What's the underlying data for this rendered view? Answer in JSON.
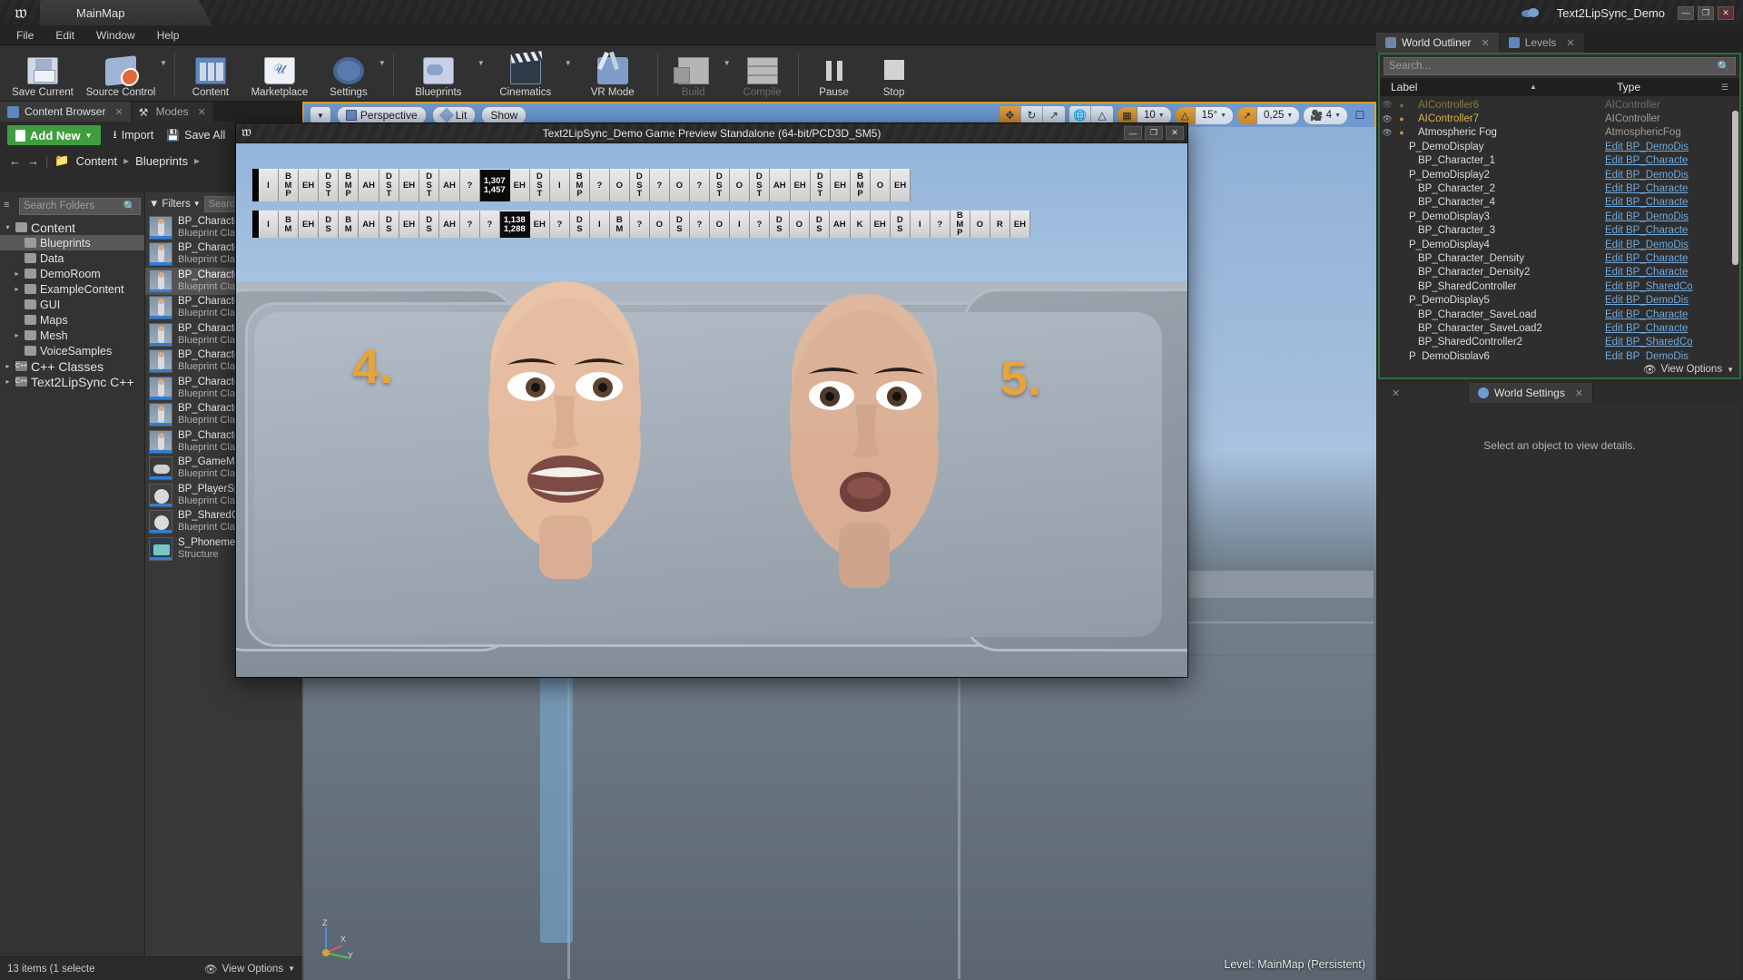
{
  "titlebar": {
    "map_tab": "MainMap",
    "project_name": "Text2LipSync_Demo",
    "minimize": "—",
    "maximize": "❐",
    "close": "✕",
    "cloud_icon": "cloud-icon",
    "logo_icon": "unreal-logo-icon"
  },
  "menubar": {
    "items": [
      "File",
      "Edit",
      "Window",
      "Help"
    ]
  },
  "toolbar": {
    "groups": [
      {
        "buttons": [
          {
            "label": "Save Current",
            "icon": "save-icon",
            "caret": false,
            "disabled": false
          },
          {
            "label": "Source Control",
            "icon": "source-control-icon",
            "caret": true,
            "disabled": false
          }
        ]
      },
      {
        "buttons": [
          {
            "label": "Content",
            "icon": "content-icon",
            "caret": false,
            "disabled": false
          },
          {
            "label": "Marketplace",
            "icon": "marketplace-icon",
            "caret": false,
            "disabled": false
          },
          {
            "label": "Settings",
            "icon": "settings-gear-icon",
            "caret": true,
            "disabled": false
          }
        ]
      },
      {
        "buttons": [
          {
            "label": "Blueprints",
            "icon": "blueprints-icon",
            "caret": true,
            "disabled": false
          },
          {
            "label": "Cinematics",
            "icon": "cinematics-icon",
            "caret": true,
            "disabled": false
          },
          {
            "label": "VR Mode",
            "icon": "vr-mode-icon",
            "caret": false,
            "disabled": false
          }
        ]
      },
      {
        "buttons": [
          {
            "label": "Build",
            "icon": "build-icon",
            "caret": true,
            "disabled": true
          },
          {
            "label": "Compile",
            "icon": "compile-icon",
            "caret": false,
            "disabled": true
          }
        ]
      },
      {
        "buttons": [
          {
            "label": "Pause",
            "icon": "pause-icon",
            "caret": false,
            "disabled": false
          },
          {
            "label": "Stop",
            "icon": "stop-icon",
            "caret": false,
            "disabled": false
          }
        ]
      }
    ]
  },
  "content_browser": {
    "tabs": [
      {
        "label": "Content Browser",
        "icon": "content-browser-icon",
        "active": true
      },
      {
        "label": "Modes",
        "icon": "modes-icon",
        "active": false
      }
    ],
    "add_new": "Add New",
    "import": "Import",
    "save_all": "Save All",
    "breadcrumb": [
      "Content",
      "Blueprints"
    ],
    "folder_search_placeholder": "Search Folders",
    "asset_search_placeholder": "Search Blueprints",
    "filters_label": "Filters",
    "tree": [
      {
        "label": "Content",
        "depth": 0,
        "twisty": "▾",
        "selected": false,
        "root": true
      },
      {
        "label": "Blueprints",
        "depth": 1,
        "twisty": "",
        "selected": true
      },
      {
        "label": "Data",
        "depth": 1,
        "twisty": "",
        "selected": false
      },
      {
        "label": "DemoRoom",
        "depth": 1,
        "twisty": "▸",
        "selected": false
      },
      {
        "label": "ExampleContent",
        "depth": 1,
        "twisty": "▸",
        "selected": false
      },
      {
        "label": "GUI",
        "depth": 1,
        "twisty": "",
        "selected": false
      },
      {
        "label": "Maps",
        "depth": 1,
        "twisty": "",
        "selected": false
      },
      {
        "label": "Mesh",
        "depth": 1,
        "twisty": "▸",
        "selected": false
      },
      {
        "label": "VoiceSamples",
        "depth": 1,
        "twisty": "",
        "selected": false
      },
      {
        "label": "C++ Classes",
        "depth": 0,
        "twisty": "▸",
        "selected": false,
        "cpp": true,
        "root": true
      },
      {
        "label": "Text2LipSync C++",
        "depth": 0,
        "twisty": "▸",
        "selected": false,
        "cpp": true,
        "root": true
      }
    ],
    "assets": [
      {
        "name": "BP_Character_Bas",
        "type": "Blueprint Class",
        "thumb": "character",
        "selected": false
      },
      {
        "name": "BP_Character_Bas",
        "type": "Blueprint Class",
        "thumb": "character",
        "selected": false
      },
      {
        "name": "BP_Character_Data",
        "type": "Blueprint Class",
        "thumb": "character",
        "selected": true
      },
      {
        "name": "BP_Character_Data",
        "type": "Blueprint Class",
        "thumb": "character",
        "selected": false
      },
      {
        "name": "BP_Character_Data",
        "type": "Blueprint Class",
        "thumb": "character",
        "selected": false
      },
      {
        "name": "BP_Character_Den",
        "type": "Blueprint Class",
        "thumb": "character",
        "selected": false
      },
      {
        "name": "BP_Character_Noti",
        "type": "Blueprint Class",
        "thumb": "character",
        "selected": false
      },
      {
        "name": "BP_Character_Play",
        "type": "Blueprint Class",
        "thumb": "character",
        "selected": false
      },
      {
        "name": "BP_Character_Sav",
        "type": "Blueprint Class",
        "thumb": "character",
        "selected": false
      },
      {
        "name": "BP_GameMode",
        "type": "Blueprint Class",
        "thumb": "gamemode",
        "selected": false
      },
      {
        "name": "BP_PlayerSpectato",
        "type": "Blueprint Class",
        "thumb": "sphere",
        "selected": false
      },
      {
        "name": "BP_SharedControl",
        "type": "Blueprint Class",
        "thumb": "sphere",
        "selected": false
      },
      {
        "name": "S_PhonemeVisuali",
        "type": "Structure",
        "thumb": "struct",
        "selected": false
      }
    ],
    "footer_status": "13 items (1 selecte",
    "view_options": "View Options"
  },
  "viewport": {
    "perspective": "Perspective",
    "lit": "Lit",
    "show": "Show",
    "grid_snap": "10",
    "angle_snap": "15°",
    "scale_snap": "0,25",
    "camera_speed": "4",
    "level_info": "Level:  MainMap (Persistent)",
    "icons": {
      "dropdown": "chevron-down-icon",
      "move": "move-gizmo-icon",
      "rotate": "rotate-gizmo-icon",
      "scale": "scale-gizmo-icon",
      "world": "world-coords-icon",
      "surface": "surface-snap-icon",
      "grid": "grid-snap-icon",
      "angle": "angle-snap-icon",
      "scale_snap": "scale-snap-icon",
      "camera": "camera-speed-icon",
      "maximize": "maximize-viewport-icon"
    },
    "axis": {
      "x": "X",
      "y": "Y",
      "z": "Z"
    }
  },
  "right_panels": {
    "tabs": [
      {
        "label": "World Outliner",
        "icon": "outliner-icon",
        "active": true
      },
      {
        "label": "Levels",
        "icon": "levels-icon",
        "active": false
      }
    ],
    "outliner": {
      "search_placeholder": "Search...",
      "col_label": "Label",
      "col_type": "Type",
      "view_options": "View Options",
      "rows": [
        {
          "label": "AIController6",
          "type": "AIController",
          "indent": 1,
          "link": false,
          "highlight": true,
          "eye": true,
          "clipped": true
        },
        {
          "label": "AIController7",
          "type": "AIController",
          "indent": 1,
          "link": false,
          "highlight": true,
          "eye": true
        },
        {
          "label": "Atmospheric Fog",
          "type": "AtmosphericFog",
          "indent": 1,
          "link": false,
          "highlight": false,
          "eye": true
        },
        {
          "label": "P_DemoDisplay",
          "type": "Edit BP_DemoDis",
          "indent": 0,
          "link": true,
          "highlight": false
        },
        {
          "label": "BP_Character_1",
          "type": "Edit BP_Characte",
          "indent": 1,
          "link": true,
          "highlight": false
        },
        {
          "label": "P_DemoDisplay2",
          "type": "Edit BP_DemoDis",
          "indent": 0,
          "link": true,
          "highlight": false
        },
        {
          "label": "BP_Character_2",
          "type": "Edit BP_Characte",
          "indent": 1,
          "link": true,
          "highlight": false
        },
        {
          "label": "BP_Character_4",
          "type": "Edit BP_Characte",
          "indent": 1,
          "link": true,
          "highlight": false
        },
        {
          "label": "P_DemoDisplay3",
          "type": "Edit BP_DemoDis",
          "indent": 0,
          "link": true,
          "highlight": false
        },
        {
          "label": "BP_Character_3",
          "type": "Edit BP_Characte",
          "indent": 1,
          "link": true,
          "highlight": false
        },
        {
          "label": "P_DemoDisplay4",
          "type": "Edit BP_DemoDis",
          "indent": 0,
          "link": true,
          "highlight": false
        },
        {
          "label": "BP_Character_Density",
          "type": "Edit BP_Characte",
          "indent": 1,
          "link": true,
          "highlight": false
        },
        {
          "label": "BP_Character_Density2",
          "type": "Edit BP_Characte",
          "indent": 1,
          "link": true,
          "highlight": false
        },
        {
          "label": "BP_SharedController",
          "type": "Edit BP_SharedCo",
          "indent": 1,
          "link": true,
          "highlight": false
        },
        {
          "label": "P_DemoDisplay5",
          "type": "Edit BP_DemoDis",
          "indent": 0,
          "link": true,
          "highlight": false
        },
        {
          "label": "BP_Character_SaveLoad",
          "type": "Edit BP_Characte",
          "indent": 1,
          "link": true,
          "highlight": false
        },
        {
          "label": "BP_Character_SaveLoad2",
          "type": "Edit BP_Characte",
          "indent": 1,
          "link": true,
          "highlight": false
        },
        {
          "label": "BP_SharedController2",
          "type": "Edit BP_SharedCo",
          "indent": 1,
          "link": true,
          "highlight": false
        },
        {
          "label": "P_DemoDisplay6",
          "type": "Edit BP_DemoDis",
          "indent": 0,
          "link": true,
          "highlight": false
        }
      ]
    },
    "world_settings": {
      "tab_label": "World Settings",
      "message": "Select an object to view details."
    }
  },
  "game_window": {
    "title": "Text2LipSync_Demo Game Preview Standalone (64-bit/PCD3D_SM5)",
    "minimize": "—",
    "maximize": "❐",
    "close": "✕",
    "digit_left": "4.",
    "digit_right": "5.",
    "phoneme_rows": [
      {
        "row_id": "phoneme-row-top",
        "cells": [
          {
            "text": "I",
            "dark": false
          },
          {
            "text": "B\nM\nP",
            "dark": false
          },
          {
            "text": "EH",
            "dark": false
          },
          {
            "text": "D\nS\nT",
            "dark": false
          },
          {
            "text": "B\nM\nP",
            "dark": false
          },
          {
            "text": "AH",
            "dark": false
          },
          {
            "text": "D\nS\nT",
            "dark": false
          },
          {
            "text": "EH",
            "dark": false
          },
          {
            "text": "D\nS\nT",
            "dark": false
          },
          {
            "text": "AH",
            "dark": false
          },
          {
            "text": "?",
            "dark": false
          },
          {
            "text": "1,307\n1,457",
            "dark": true
          },
          {
            "text": "EH",
            "dark": false
          },
          {
            "text": "D\nS\nT",
            "dark": false
          },
          {
            "text": "I",
            "dark": false
          },
          {
            "text": "B\nM\nP",
            "dark": false
          },
          {
            "text": "?",
            "dark": false
          },
          {
            "text": "O",
            "dark": false
          },
          {
            "text": "D\nS\nT",
            "dark": false
          },
          {
            "text": "?",
            "dark": false
          },
          {
            "text": "O",
            "dark": false
          },
          {
            "text": "?",
            "dark": false
          },
          {
            "text": "D\nS\nT",
            "dark": false
          },
          {
            "text": "O",
            "dark": false
          },
          {
            "text": "D\nS\nT",
            "dark": false
          },
          {
            "text": "AH",
            "dark": false
          },
          {
            "text": "EH",
            "dark": false
          },
          {
            "text": "D\nS\nT",
            "dark": false
          },
          {
            "text": "EH",
            "dark": false
          },
          {
            "text": "B\nM\nP",
            "dark": false
          },
          {
            "text": "O",
            "dark": false
          },
          {
            "text": "EH",
            "dark": false
          }
        ]
      },
      {
        "row_id": "phoneme-row-bottom",
        "cells": [
          {
            "text": "I",
            "dark": false
          },
          {
            "text": "B\nM",
            "dark": false
          },
          {
            "text": "EH",
            "dark": false
          },
          {
            "text": "D\nS",
            "dark": false
          },
          {
            "text": "B\nM",
            "dark": false
          },
          {
            "text": "AH",
            "dark": false
          },
          {
            "text": "D\nS",
            "dark": false
          },
          {
            "text": "EH",
            "dark": false
          },
          {
            "text": "D\nS",
            "dark": false
          },
          {
            "text": "AH",
            "dark": false
          },
          {
            "text": "?",
            "dark": false
          },
          {
            "text": "?",
            "dark": false
          },
          {
            "text": "1,138\n1,288",
            "dark": true
          },
          {
            "text": "EH",
            "dark": false
          },
          {
            "text": "?",
            "dark": false
          },
          {
            "text": "D\nS",
            "dark": false
          },
          {
            "text": "I",
            "dark": false
          },
          {
            "text": "B\nM",
            "dark": false
          },
          {
            "text": "?",
            "dark": false
          },
          {
            "text": "O",
            "dark": false
          },
          {
            "text": "D\nS",
            "dark": false
          },
          {
            "text": "?",
            "dark": false
          },
          {
            "text": "O",
            "dark": false
          },
          {
            "text": "I",
            "dark": false
          },
          {
            "text": "?",
            "dark": false
          },
          {
            "text": "D\nS",
            "dark": false
          },
          {
            "text": "O",
            "dark": false
          },
          {
            "text": "D\nS",
            "dark": false
          },
          {
            "text": "AH",
            "dark": false
          },
          {
            "text": "K",
            "dark": false
          },
          {
            "text": "EH",
            "dark": false
          },
          {
            "text": "D\nS",
            "dark": false
          },
          {
            "text": "I",
            "dark": false
          },
          {
            "text": "?",
            "dark": false
          },
          {
            "text": "B\nM\nP",
            "dark": false
          },
          {
            "text": "O",
            "dark": false
          },
          {
            "text": "R",
            "dark": false
          },
          {
            "text": "EH",
            "dark": false
          }
        ]
      }
    ]
  },
  "colors": {
    "accent_orange": "#d9a12c",
    "viewport_blue": "#6e9ad1",
    "add_new_green": "#3e9d3e",
    "outliner_border_green": "#2f6b3a",
    "link_blue": "#6fa8dc"
  }
}
